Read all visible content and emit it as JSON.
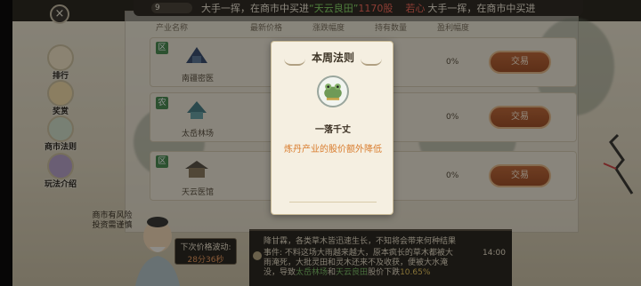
{
  "ticker": {
    "counter": "9",
    "seg1_prefix": "大手一挥，在商市中买进",
    "seg1_item": "“天云良田”",
    "seg1_amount": "1170股",
    "seg2_name": "若心",
    "seg2_text": "大手一挥，在商市中买进"
  },
  "nav": {
    "close_label": "×",
    "items": [
      {
        "label": "排行"
      },
      {
        "label": "奖赏"
      },
      {
        "label": "商市法则"
      },
      {
        "label": "玩法介绍"
      }
    ]
  },
  "table": {
    "headers": [
      "产业名称",
      "最新价格",
      "涨跌幅度",
      "持有数量",
      "盈利幅度"
    ],
    "rows": [
      {
        "badge": "区",
        "name": "南疆密医",
        "profit": "0%",
        "trade_label": "交易"
      },
      {
        "badge": "农",
        "name": "太岳林场",
        "profit": "0%",
        "trade_label": "交易"
      },
      {
        "badge": "区",
        "name": "天云医馆",
        "profit": "0%",
        "trade_label": "交易"
      }
    ]
  },
  "advisor": {
    "tip": "商市有风险 投资需谨慎",
    "next_label": "下次价格波动:",
    "next_time": "28分36秒"
  },
  "announcement": {
    "line1": "降甘霖，各类草木皆迅速生长，不知将会带来何种结果",
    "event_label": "事件:",
    "event_text": "不料这场大雨越来越大，原本疯长的草木都被大雨淹死，大批灵田和灵木还来不及收获，便被大水淹没，导致",
    "event_hl1": "太岳林场",
    "event_mid": "和",
    "event_hl2": "天云良田",
    "event_tail": "股价下跌",
    "event_pct": "10.65%",
    "time": "14:00"
  },
  "modal": {
    "title": "本周法则",
    "law_name": "一落千丈",
    "law_desc": "炼丹产业的股价额外降低"
  }
}
